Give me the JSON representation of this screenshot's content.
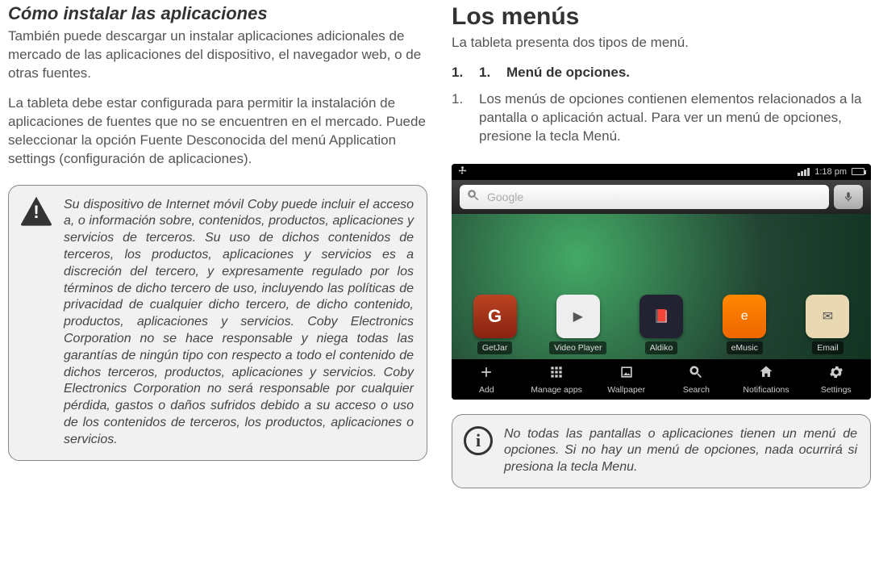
{
  "left": {
    "title": "Cómo instalar las aplicaciones",
    "p1": "También puede descargar un instalar aplicaciones adicionales de mercado de las aplicaciones del dispositivo, el navegador web, o de otras fuentes.",
    "p2": "La tableta debe estar configurada para permitir la instalación de aplicaciones de fuentes que no se encuentren en el mercado. Puede seleccionar la opción Fuente Desconocida del menú Application settings (configuración de aplicaciones).",
    "warning": "Su dispositivo de Internet móvil Coby puede incluir el acceso a, o información sobre, contenidos, productos, aplicaciones y servicios de terceros. Su uso de dichos contenidos de terceros, los productos, aplicaciones y servicios es a discreción del tercero, y expresamente regulado por los términos de dicho tercero de uso, incluyendo las políticas de privacidad de cualquier dicho tercero, de dicho contenido, productos, aplicaciones y servicios. Coby Electronics Corporation no se hace responsable y niega todas las garantías de ningún tipo con respecto a todo el contenido de dichos terceros, productos, aplicaciones y servicios. Coby Electronics Corporation no será responsable por cualquier pérdida, gastos o daños sufridos debido a su acceso o uso de los contenidos de terceros, los productos, aplicaciones o servicios."
  },
  "right": {
    "title": "Los menús",
    "intro": "La tableta presenta dos tipos de menú.",
    "item1_num1": "1.",
    "item1_num2": "1.",
    "item1_text": "Menú de opciones.",
    "item2_num": "1.",
    "item2_text": "Los menús de opciones contienen elementos relacionados a la pantalla o aplicación actual. Para ver un menú de opciones, presione la tecla Menú.",
    "info": "No todas las pantallas o aplicaciones tienen un menú de opciones. Si no hay un menú de opciones, nada ocurrirá si presiona la tecla Menu."
  },
  "screenshot": {
    "time": "1:18 pm",
    "search_placeholder": "Google",
    "apps": [
      {
        "label": "GetJar",
        "class": "getjar",
        "glyph": "G"
      },
      {
        "label": "Video Player",
        "class": "videoplayer",
        "glyph": "▶"
      },
      {
        "label": "Aldiko",
        "class": "aldiko",
        "glyph": "📕"
      },
      {
        "label": "eMusic",
        "class": "emusic",
        "glyph": "e"
      },
      {
        "label": "Email",
        "class": "email",
        "glyph": "✉"
      }
    ],
    "menu": [
      {
        "label": "Add",
        "name": "menu-add"
      },
      {
        "label": "Manage apps",
        "name": "menu-manage-apps"
      },
      {
        "label": "Wallpaper",
        "name": "menu-wallpaper"
      },
      {
        "label": "Search",
        "name": "menu-search"
      },
      {
        "label": "Notifications",
        "name": "menu-notifications"
      },
      {
        "label": "Settings",
        "name": "menu-settings"
      }
    ]
  }
}
